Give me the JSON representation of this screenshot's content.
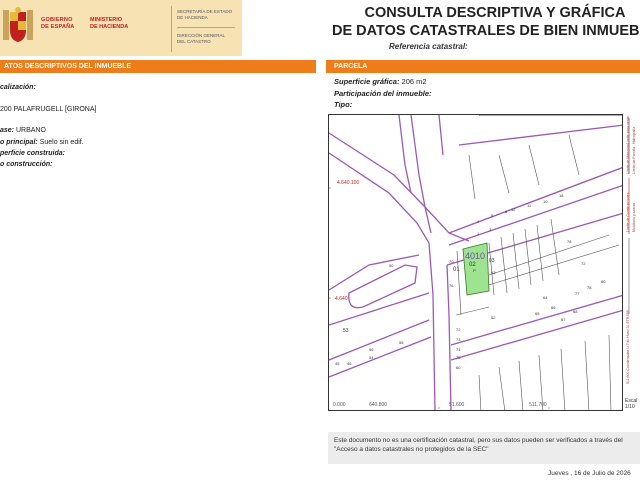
{
  "header": {
    "gobierno": "GOBIERNO",
    "espana": "DE ESPAÑA",
    "ministerio": "MINISTERIO",
    "hacienda": "DE HACIENDA",
    "secretaria_1": "SECRETARÍA DE ESTADO",
    "secretaria_2": "DE HACIENDA",
    "direccion_1": "DIRECCIÓN GENERAL",
    "direccion_2": "DEL CATASTRO",
    "title_1": "CONSULTA DESCRIPTIVA Y GRÁFICA",
    "title_2": "DE DATOS CATASTRALES DE BIEN INMUEBLE",
    "referencia_label": "Referencia catastral:"
  },
  "left": {
    "section_title": "ATOS DESCRIPTIVOS DEL INMUEBLE",
    "localizacion_label": "calización:",
    "address": "200 PALAFRUGELL [GIRONA]",
    "clase_label": "ase:",
    "clase_value": "URBANO",
    "uso_label": "o principal:",
    "uso_value": "Suelo sin edif.",
    "superficie_label": "perficie construida:",
    "anio_label": "o construcción:"
  },
  "right": {
    "section_title": "PARCELA",
    "superficie_label": "Superficie gráfica:",
    "superficie_value": "206 m2",
    "participacion_label": "Participación del inmueble:",
    "tipo_label": "Tipo:"
  },
  "map": {
    "coord_labels": [
      "4.640.100",
      "4.640",
      "0.000",
      "51.600",
      "511.700",
      "640.800"
    ],
    "block_labels": [
      "4010",
      "02",
      "P",
      "01",
      "03",
      "63",
      "76",
      "53",
      "70",
      "64",
      "60",
      "65",
      "50",
      "52",
      "72",
      "73",
      "74",
      "75",
      "68",
      "67",
      "66",
      "80",
      "78",
      "77",
      "55",
      "56",
      "54",
      "45",
      "46",
      "78",
      "72",
      "10",
      "11",
      "12",
      "1",
      "3",
      "4",
      "5",
      "6",
      "18"
    ],
    "highlight_color": "#9ee38f",
    "street_color": "#9b59b6"
  },
  "legend": {
    "labels": [
      "Límite de Manzana",
      "Límite de Parcela",
      "Límite de Construcciones",
      "Mobiliario y aceras",
      "Límite zona verde",
      "Hidrografía"
    ],
    "coords_text": "511,600 Coordenadas U.T.M. Huso 31 ETRS89",
    "escala_label": "Escal",
    "escala_value": "1/10"
  },
  "footer": {
    "note": "Este documento no es una certificación catastral, pero sus datos pueden ser verificados a través del \"Acceso a datos catastrales no protegidos de la SEC\"",
    "date": "Jueves , 16 de Julio de 2026"
  }
}
